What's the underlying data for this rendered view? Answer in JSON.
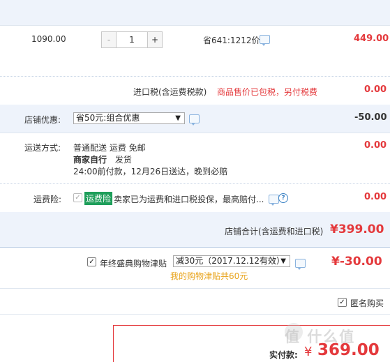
{
  "item": {
    "unit_price": "1090.00",
    "qty_minus": "-",
    "qty_value": "1",
    "qty_plus": "+",
    "savings": "省641:1212价",
    "subtotal": "449.00"
  },
  "tax": {
    "label": "进口税(含运费税款)",
    "note": "商品售价已包税，另付税费",
    "value": "0.00"
  },
  "discount": {
    "label": "店铺优惠:",
    "selected": "省50元:组合优惠",
    "value": "-50.00"
  },
  "shipping": {
    "label": "运送方式:",
    "line1": "普通配送 运费 免邮",
    "line2_bold": "商家自行",
    "line2_rest": "发货",
    "line3": "24:00前付款，12月26日送达，晚到必赔",
    "value": "0.00"
  },
  "insurance": {
    "label": "运费险:",
    "badge": "运费险",
    "text": "卖家已为运费和进口税投保，最高赔付...",
    "value": "0.00"
  },
  "store_total": {
    "label": "店铺合计(含运费和进口税)",
    "value": "¥399.00"
  },
  "subsidy": {
    "label": "年终盛典购物津贴",
    "selected": "减30元（2017.12.12有效）",
    "note": "我的购物津贴共60元",
    "value": "¥-30.00"
  },
  "anonymous": {
    "label": "匿名购买"
  },
  "payment": {
    "label": "实付款:",
    "currency": "¥",
    "amount": "369.00"
  },
  "watermark": {
    "text": "值 什么值"
  },
  "colors": {
    "accent_red": "#e4393c",
    "band_blue": "#eef3fb",
    "badge_green": "#1e9e5a",
    "subsidy_note": "#e8a31a"
  }
}
